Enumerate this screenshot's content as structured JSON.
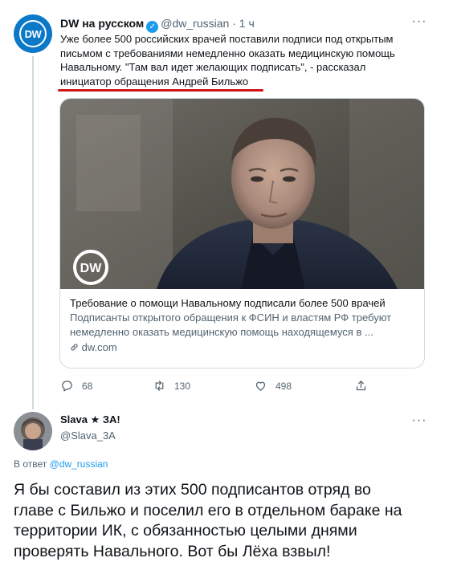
{
  "tweet1": {
    "author_name": "DW на русском",
    "author_handle": "@dw_russian",
    "separator": "·",
    "time": "1 ч",
    "avatar_text": "DW",
    "text_lines": [
      "Уже более 500 российских врачей поставили подписи под открытым",
      "письмом с требованиями немедленно оказать медицинскую помощь",
      "Навальному. \"Там вал идет желающих подписать\", - рассказал",
      "инициатор обращения Андрей Бильжо"
    ],
    "card": {
      "watermark": "DW",
      "title": "Требование о помощи Навальному подписали более 500 врачей",
      "description_lines": [
        "Подписанты открытого обращения к ФСИН и властям РФ требуют",
        "немедленно оказать медицинскую помощь находящемуся в ..."
      ],
      "link": "dw.com"
    },
    "actions": {
      "replies": "68",
      "retweets": "130",
      "likes": "498"
    }
  },
  "tweet2": {
    "author_name": "Slava ★ ЗА!",
    "author_handle": "@Slava_3A",
    "reply_prefix": "В ответ ",
    "reply_handle": "@dw_russian",
    "text_lines": [
      "Я бы составил из этих 500 подписантов отряд во",
      "главе с Бильжо и поселил его в отдельном бараке на",
      "территории ИК, с обязанностью целыми днями",
      "проверять Навального. Вот бы Лёха взвыл!"
    ]
  },
  "colors": {
    "accent": "#1d9bf0",
    "dw_blue": "#0b79c8",
    "secondary_text": "#536471",
    "underline": "#d0141b"
  },
  "icons": [
    "more-icon",
    "verified-icon",
    "reply-icon",
    "retweet-icon",
    "like-icon",
    "share-icon",
    "link-icon"
  ]
}
